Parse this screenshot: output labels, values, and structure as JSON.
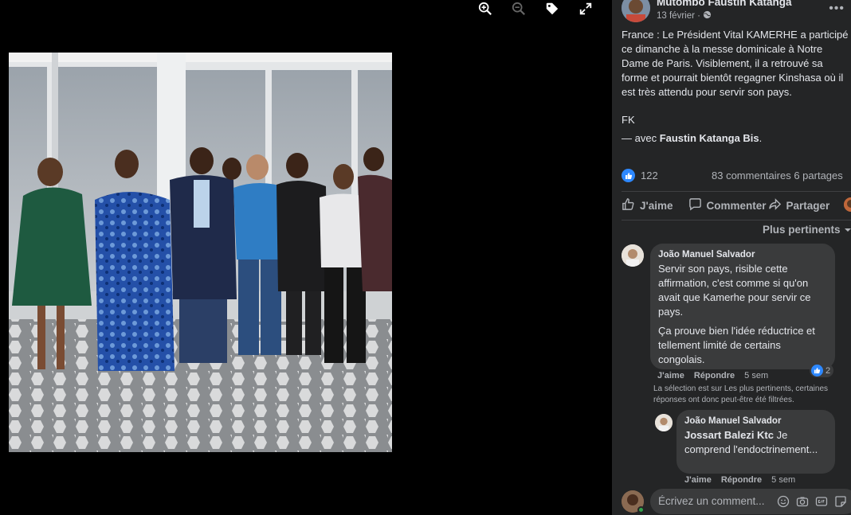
{
  "viewer": {
    "tools": [
      "zoom-in-icon",
      "zoom-out-icon",
      "tag-icon",
      "fullscreen-icon"
    ]
  },
  "post": {
    "author": "Mutombo Faustin Katanga",
    "date": "13 février · ",
    "text": "France : Le Président Vital KAMERHE a participé ce dimanche à la messe dominicale à Notre Dame de Paris. Visiblement, il a retrouvé sa forme et pourrait bientôt regagner Kinshasa où il est très attendu pour servir son pays.",
    "sign": "FK",
    "with_prefix": "— avec ",
    "with_name": "Faustin Katanga Bis",
    "with_suffix": ".",
    "likes": "122",
    "comments_shares": "83 commentaires  6 partages"
  },
  "actions": {
    "like": "J'aime",
    "comment": "Commenter",
    "share": "Partager"
  },
  "sort_label": "Plus pertinents",
  "comments": [
    {
      "author": "João Manuel Salvador",
      "para1": "Servir son pays, risible cette affirmation, c'est comme si qu'on avait que Kamerhe pour servir ce pays.",
      "para2": "Ça prouve bien l'idée réductrice et tellement limité de certains congolais.",
      "reactions": "2",
      "like": "J'aime",
      "reply": "Répondre",
      "time": "5 sem"
    },
    {
      "author": "João Manuel Salvador",
      "mention": "Jossart Balezi Ktc",
      "text": " Je comprend l'endoctrinement...",
      "like": "J'aime",
      "reply": "Répondre",
      "time": "5 sem"
    }
  ],
  "filter_notice": "La sélection est sur Les plus pertinents, certaines réponses ont donc peut-être été filtrées.",
  "composer": {
    "placeholder": "Écrivez un comment..."
  },
  "colors": {
    "panel_bg": "#242526",
    "bubble_bg": "#3a3b3c",
    "accent": "#2d88ff"
  }
}
